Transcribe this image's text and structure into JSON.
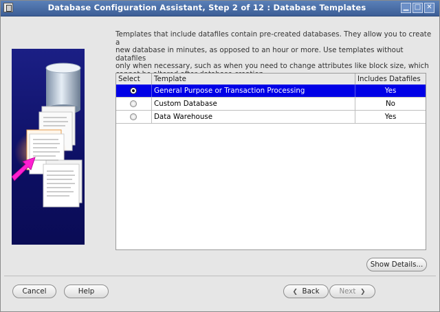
{
  "window": {
    "title": "Database Configuration Assistant, Step 2 of 12 : Database Templates",
    "controls": {
      "minimize": "▁",
      "maximize": "□",
      "close": "✕"
    }
  },
  "description": "Templates that include datafiles contain pre-created databases. They allow you to create a\nnew database in minutes, as opposed to an hour or more. Use templates without datafiles\nonly when necessary, such as when you need to change attributes like block size, which\ncannot be altered after database creation.",
  "templates_table": {
    "columns": [
      "Select",
      "Template",
      "Includes Datafiles"
    ],
    "rows": [
      {
        "selected": true,
        "template": "General Purpose or Transaction Processing",
        "includes_datafiles": "Yes"
      },
      {
        "selected": false,
        "template": "Custom Database",
        "includes_datafiles": "No"
      },
      {
        "selected": false,
        "template": "Data Warehouse",
        "includes_datafiles": "Yes"
      }
    ]
  },
  "buttons": {
    "show_details": "Show Details...",
    "cancel": "Cancel",
    "help": "Help",
    "back": "Back",
    "next": "Next"
  },
  "icons": {
    "back": "left-chevron-icon",
    "next": "right-chevron-icon"
  },
  "colors": {
    "titlebar": "#4a6ea8",
    "selection": "#0000e6",
    "art_panel": "#12147a"
  }
}
